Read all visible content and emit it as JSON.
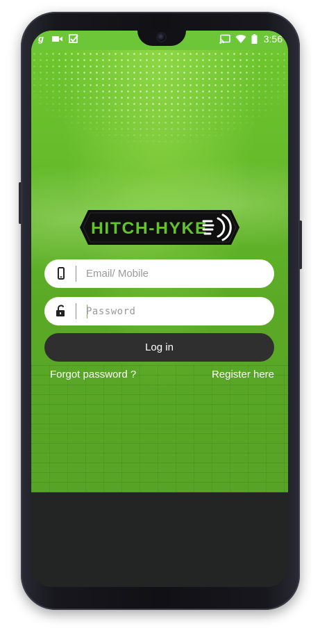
{
  "status_bar": {
    "left_icons": [
      "g-app-icon",
      "video-camera-icon",
      "checkbox-icon"
    ],
    "right_icons": [
      "cast-icon",
      "wifi-icon",
      "battery-icon"
    ],
    "time": "3:56"
  },
  "logo": {
    "text": "HITCH-HYKE"
  },
  "login_form": {
    "email": {
      "icon": "mobile-phone-icon",
      "placeholder": "Email/ Mobile",
      "value": ""
    },
    "password": {
      "icon": "unlock-icon",
      "placeholder": "Password",
      "value": ""
    },
    "login_label": "Log in",
    "forgot_label": "Forgot password ?",
    "register_label": "Register here"
  },
  "colors": {
    "brand_green": "#6cc638",
    "button_dark": "#2f2f30",
    "field_bg": "#ffffff",
    "bottom_dark": "#232524"
  }
}
